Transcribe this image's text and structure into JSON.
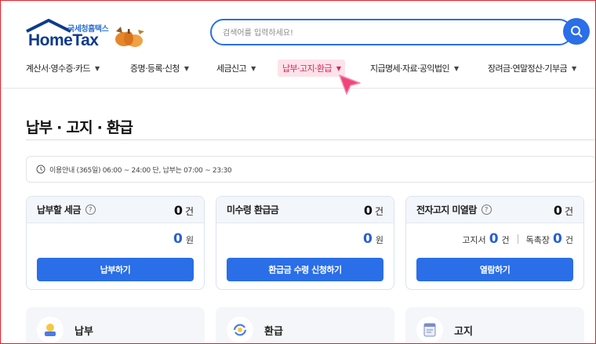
{
  "logo": {
    "sub": "국세청홈택스",
    "main": "HomeTax"
  },
  "search": {
    "placeholder": "검색어를 입력하세요!"
  },
  "gnb": [
    {
      "label": "계산서·영수증·카드"
    },
    {
      "label": "증명·등록·신청"
    },
    {
      "label": "세금신고"
    },
    {
      "label": "납부·고지·환급",
      "active": true
    },
    {
      "label": "지급명세·자료·공익법인"
    },
    {
      "label": "장려금·연말정산·기부금"
    }
  ],
  "page": {
    "title": "납부 · 고지 · 환급",
    "notice": "이용안내 (365일) 06:00 ~ 24:00 단, 납부는 07:00 ~ 23:30"
  },
  "cards": [
    {
      "title": "납부할 세금",
      "count": "0",
      "count_unit": "건",
      "amount": "0",
      "amount_unit": "원",
      "button": "납부하기"
    },
    {
      "title": "미수령 환급금",
      "count": "0",
      "count_unit": "건",
      "amount": "0",
      "amount_unit": "원",
      "button": "환급금 수령 신청하기"
    },
    {
      "title": "전자고지 미열람",
      "count": "0",
      "count_unit": "건",
      "left_label": "고지서",
      "left_value": "0",
      "left_unit": "건",
      "right_label": "독촉장",
      "right_value": "0",
      "right_unit": "건",
      "button": "열람하기"
    }
  ],
  "bottom": [
    {
      "label": "납부",
      "icon": "payment-icon"
    },
    {
      "label": "환급",
      "icon": "refund-icon"
    },
    {
      "label": "고지",
      "icon": "notice-bill-icon"
    }
  ],
  "colors": {
    "primary": "#2a6ee8",
    "active_menu_bg": "#fde2ea",
    "active_menu_text": "#d6245d",
    "cursor": "#f2437c"
  }
}
